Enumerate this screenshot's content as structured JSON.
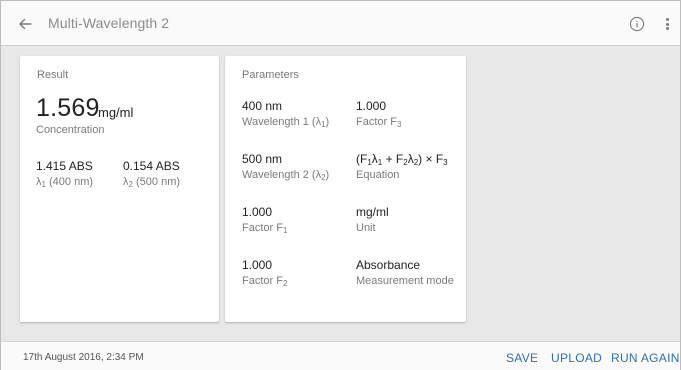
{
  "header": {
    "title": "Multi-Wavelength 2",
    "back_icon": "arrow-left-icon",
    "info_icon": "info-icon",
    "more_icon": "more-vertical-icon"
  },
  "result": {
    "card_title": "Result",
    "concentration_value": "1.569",
    "concentration_unit": "mg/ml",
    "concentration_label": "Concentration",
    "abs1_value": "1.415 ABS",
    "abs1_label_main": "λ",
    "abs1_label_sub": "1",
    "abs1_label_rest": " (400 nm)",
    "abs2_value": "0.154 ABS",
    "abs2_label_main": "λ",
    "abs2_label_sub": "2",
    "abs2_label_rest": " (500 nm)"
  },
  "parameters": {
    "card_title": "Parameters",
    "items": [
      {
        "value": "400 nm",
        "label": "Wavelength 1 (λ",
        "label_sub": "1",
        "label_end": ")"
      },
      {
        "value": "1.000",
        "label": "Factor F",
        "label_sub": "3",
        "label_end": ""
      },
      {
        "value": "500 nm",
        "label": "Wavelength 2 (λ",
        "label_sub": "2",
        "label_end": ")"
      },
      {
        "value": "(F1λ1 + F2λ2) × F3",
        "label": "Equation",
        "label_sub": "",
        "label_end": ""
      },
      {
        "value": "1.000",
        "label": "Factor F",
        "label_sub": "1",
        "label_end": ""
      },
      {
        "value": "mg/ml",
        "label": "Unit",
        "label_sub": "",
        "label_end": ""
      },
      {
        "value": "1.000",
        "label": "Factor F",
        "label_sub": "2",
        "label_end": ""
      },
      {
        "value": "Absorbance",
        "label": "Measurement mode",
        "label_sub": "",
        "label_end": ""
      }
    ]
  },
  "footer": {
    "timestamp": "17th August 2016, 2:34 PM",
    "save_label": "SAVE",
    "upload_label": "UPLOAD",
    "run_again_label": "RUN AGAIN"
  },
  "colors": {
    "accent": "#2f6fae",
    "background": "#e8e8e8",
    "card": "#ffffff"
  }
}
